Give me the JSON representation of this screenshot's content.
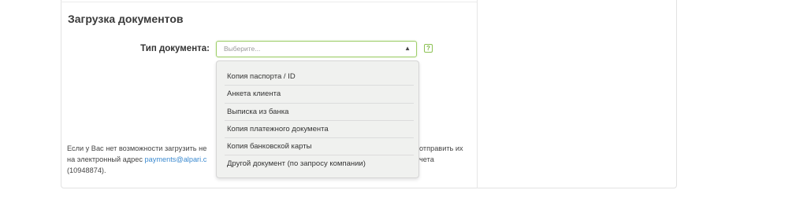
{
  "section": {
    "title": "Загрузка документов"
  },
  "form": {
    "doc_type_label": "Тип документа:",
    "select_placeholder": "Выберите...",
    "help_glyph": "?",
    "arrow_glyph": "▲"
  },
  "dropdown": {
    "options": [
      "Копия паспорта / ID",
      "Анкета клиента",
      "Выписка из банка",
      "Копия платежного документа",
      "Копия банковской карты",
      "Другой документ (по запросу компании)"
    ]
  },
  "note": {
    "line1_left": "Если у Вас нет возможности загрузить не",
    "line1_right": "отправить их",
    "line2_left": "на электронный адрес",
    "email_partial": "payments@alpari.c",
    "line2_right": "чета",
    "line3": "(10948874)."
  },
  "colors": {
    "accent_green": "#9fce6a",
    "link_blue": "#3b8ad0"
  }
}
